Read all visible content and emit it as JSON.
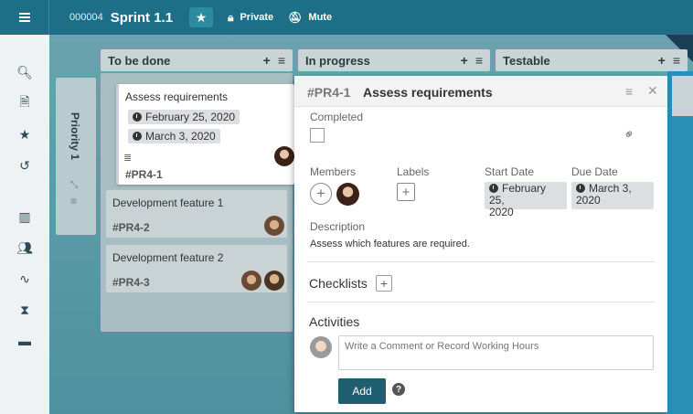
{
  "topbar": {
    "board_id": "000004",
    "board_name": "Sprint 1.1",
    "private_label": "Private",
    "mute_label": "Mute"
  },
  "sidebar": {
    "icons": [
      "search-icon",
      "add-file-icon",
      "star-icon",
      "history-icon",
      "board-icon",
      "users-icon",
      "activity-icon",
      "hourglass-icon",
      "archive-icon"
    ]
  },
  "swimlane": {
    "title": "Priority 1"
  },
  "columns": [
    {
      "title": "To be done"
    },
    {
      "title": "In progress"
    },
    {
      "title": "Testable"
    }
  ],
  "cards": [
    {
      "title": "Assess requirements",
      "start_date": "February 25, 2020",
      "due_date": "March 3, 2020",
      "id": "#PR4-1"
    },
    {
      "title": "Development feature 1",
      "id": "#PR4-2"
    },
    {
      "title": "Development feature 2",
      "id": "#PR4-3"
    }
  ],
  "detail": {
    "id": "#PR4-1",
    "title": "Assess requirements",
    "completed_label": "Completed",
    "members_label": "Members",
    "labels_label": "Labels",
    "start_date_label": "Start Date",
    "due_date_label": "Due Date",
    "start_date_line1": "February 25,",
    "start_date_line2": "2020",
    "due_date_line1": "March 3,",
    "due_date_line2": "2020",
    "description_label": "Description",
    "description": "Assess which features are required.",
    "checklists_label": "Checklists",
    "activities_label": "Activities",
    "comment_placeholder": "Write a Comment or Record Working Hours",
    "add_button": "Add"
  },
  "colors": {
    "topbar": "#1d6f87",
    "accent_button": "#1f5f70",
    "sidebar": "#eef2f4"
  }
}
